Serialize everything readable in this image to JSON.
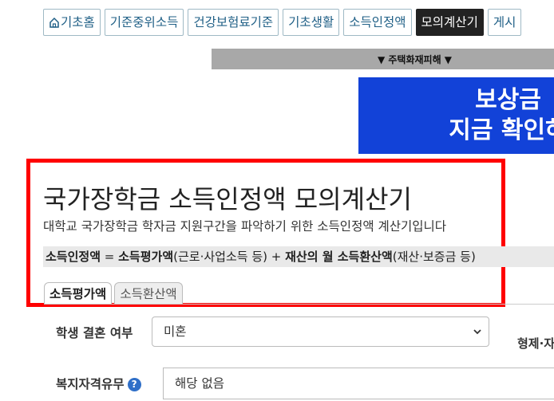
{
  "nav": {
    "items": [
      {
        "label": "기초홈",
        "icon": "home-icon"
      },
      {
        "label": "기준중위소득"
      },
      {
        "label": "건강보험료기준"
      },
      {
        "label": "기초생활"
      },
      {
        "label": "소득인정액"
      },
      {
        "label": "모의계산기",
        "active": true
      },
      {
        "label": "게시"
      }
    ]
  },
  "ad_bar": {
    "label": "▼ 주택화재피해 ▼"
  },
  "banner": {
    "line1": "보상금",
    "line2": "지금 확인하"
  },
  "page": {
    "title": "국가장학금 소득인정액 모의계산기",
    "subtitle": "대학교 국가장학금 학자금 지원구간을 파악하기 위한 소득인정액 계산기입니다",
    "formula": {
      "part1": "소득인정액",
      "part2": " = ",
      "part3": "소득평가액",
      "part4": "(근로·사업소득 등) + ",
      "part5": "재산의 월 소득환산액",
      "part6": "(재산·보증금 등)"
    }
  },
  "tabs": [
    {
      "label": "소득평가액",
      "active": true
    },
    {
      "label": "소득환산액",
      "active": false
    }
  ],
  "form": {
    "marital_label": "학생 결혼 여부",
    "marital_value": "미혼",
    "sibling_label": "형제·자",
    "welfare_label": "복지자격유무",
    "welfare_value": "해당 없음"
  },
  "colors": {
    "banner": "#1242d8",
    "highlight": "#ff0000",
    "active_tab_bg": "#222222"
  }
}
